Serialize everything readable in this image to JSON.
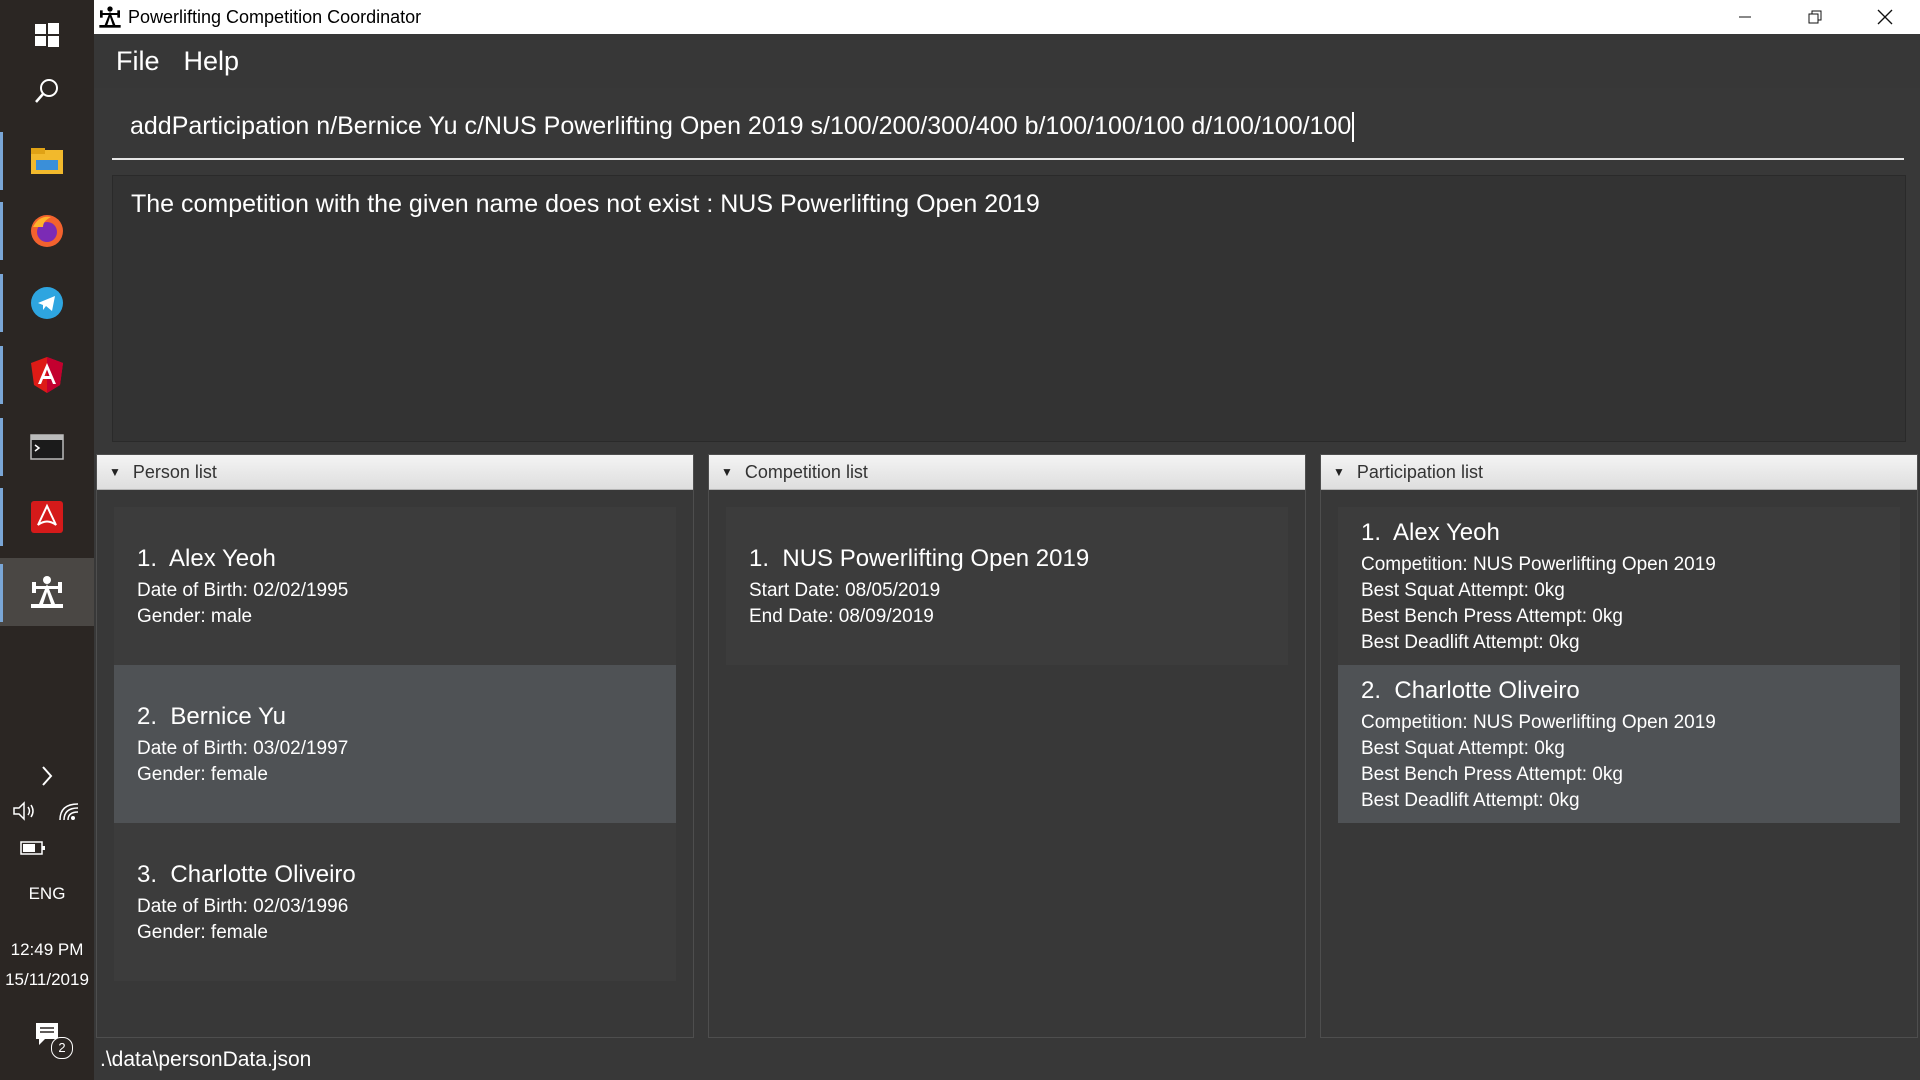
{
  "window": {
    "title": "Powerlifting Competition Coordinator"
  },
  "menu": {
    "file": "File",
    "help": "Help"
  },
  "command": {
    "value": "addParticipation n/Bernice Yu c/NUS Powerlifting Open 2019 s/100/200/300/400 b/100/100/100 d/100/100/100"
  },
  "result": {
    "message": "The competition with the given name does not exist : NUS Powerlifting Open 2019"
  },
  "person_list": {
    "header": "Person list",
    "items": [
      {
        "index": "1.",
        "name": "Alex Yeoh",
        "dob": "Date of Birth: 02/02/1995",
        "gender": "Gender: male"
      },
      {
        "index": "2.",
        "name": "Bernice Yu",
        "dob": "Date of Birth: 03/02/1997",
        "gender": "Gender: female"
      },
      {
        "index": "3.",
        "name": "Charlotte Oliveiro",
        "dob": "Date of Birth: 02/03/1996",
        "gender": "Gender: female"
      }
    ]
  },
  "competition_list": {
    "header": "Competition list",
    "items": [
      {
        "index": "1.",
        "name": "NUS Powerlifting Open 2019",
        "start": "Start Date: 08/05/2019",
        "end": "End Date: 08/09/2019"
      }
    ]
  },
  "participation_list": {
    "header": "Participation list",
    "items": [
      {
        "index": "1.",
        "name": "Alex Yeoh",
        "competition": "Competition: NUS Powerlifting Open 2019",
        "squat": "Best Squat Attempt: 0kg",
        "bench": "Best Bench Press Attempt: 0kg",
        "deadlift": "Best Deadlift Attempt: 0kg"
      },
      {
        "index": "2.",
        "name": "Charlotte Oliveiro",
        "competition": "Competition: NUS Powerlifting Open 2019",
        "squat": "Best Squat Attempt: 0kg",
        "bench": "Best Bench Press Attempt: 0kg",
        "deadlift": "Best Deadlift Attempt: 0kg"
      }
    ]
  },
  "status": {
    "path": ".\\data\\personData.json"
  },
  "taskbar": {
    "language": "ENG",
    "time": "12:49 PM",
    "date": "15/11/2019",
    "notification_count": "2",
    "icons": [
      "windows-start-icon",
      "search-icon",
      "file-explorer-icon",
      "firefox-icon",
      "telegram-icon",
      "angular-icon",
      "terminal-icon",
      "acrobat-icon",
      "powerlifting-app-icon"
    ]
  },
  "colors": {
    "background": "#383838",
    "card": "#3c3c3c",
    "card_selected": "#4f5255",
    "titlebar": "#ffffff",
    "taskbar": "#2b2623"
  }
}
